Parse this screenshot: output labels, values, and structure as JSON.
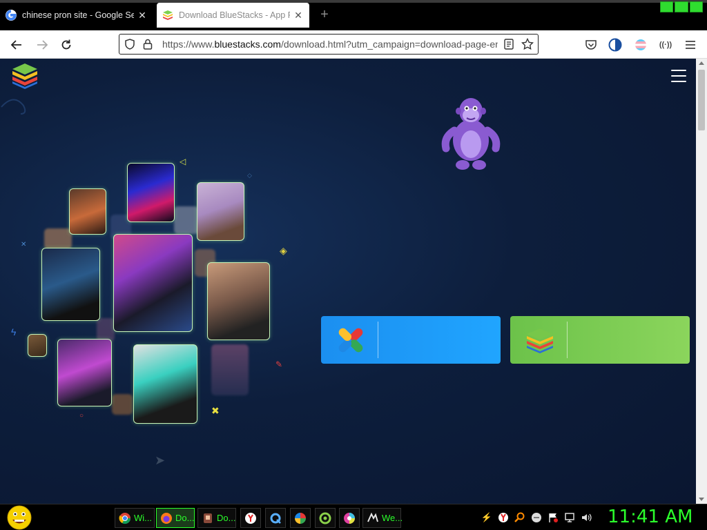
{
  "browser": {
    "tabs": [
      {
        "title": "chinese pron site - Google Search",
        "favicon": "google-g-icon",
        "active": false
      },
      {
        "title": "Download BlueStacks - App Player",
        "favicon": "bluestacks-icon",
        "active": true
      }
    ],
    "new_tab": "+",
    "url": {
      "scheme": "https://www.",
      "host": "bluestacks.com",
      "path": "/download.html?utm_campaign=download-page-en"
    },
    "colors": {
      "accent_green": "#2bff2b"
    }
  },
  "page": {
    "bg_color": "#0d1e3c",
    "download_buttons": [
      {
        "label": "",
        "icon": "bluestacks-x-icon",
        "color": "#1b8ff0"
      },
      {
        "label": "",
        "icon": "bluestacks-5-icon",
        "color": "#6cc24a"
      }
    ],
    "mascot": "bonzi-buddy-purple-gorilla"
  },
  "taskbar": {
    "items": [
      {
        "label": "Wi...",
        "icon": "chrome-icon"
      },
      {
        "label": "Do...",
        "icon": "firefox-icon",
        "active": true
      },
      {
        "label": "Do...",
        "icon": "app-icon"
      },
      {
        "label": "",
        "icon": "yandex-icon"
      },
      {
        "label": "",
        "icon": "q-icon"
      },
      {
        "label": "",
        "icon": "pinwheel-icon"
      },
      {
        "label": "",
        "icon": "green-circle-icon"
      },
      {
        "label": "",
        "icon": "chrome-color-icon"
      },
      {
        "label": "We...",
        "icon": "winamp-icon"
      }
    ],
    "clock": "11:41 AM"
  }
}
